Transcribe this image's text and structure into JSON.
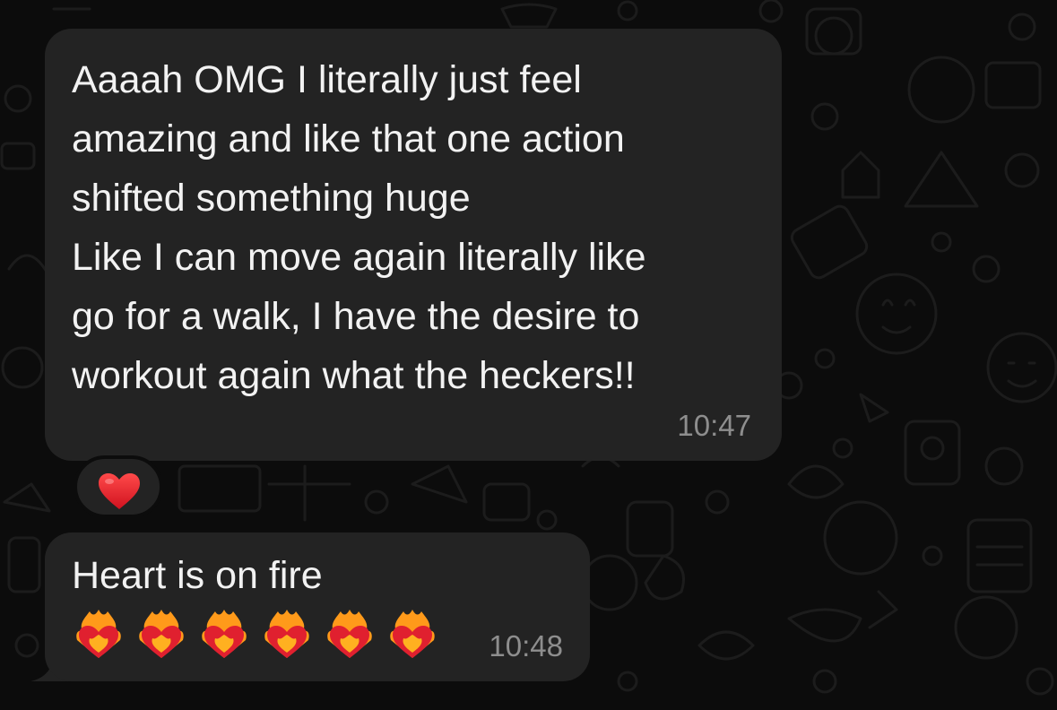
{
  "messages": [
    {
      "lines": [
        "Aaaah OMG I literally just feel",
        "amazing and like that one action",
        "shifted something huge",
        "Like I can move again literally like",
        "go for a walk, I have the desire to",
        "workout again what the heckers!!"
      ],
      "time": "10:47",
      "reaction": "red-heart-icon"
    },
    {
      "text": "Heart is on fire",
      "emojis": [
        "heart-on-fire-icon",
        "heart-on-fire-icon",
        "heart-on-fire-icon",
        "heart-on-fire-icon",
        "heart-on-fire-icon",
        "heart-on-fire-icon"
      ],
      "time": "10:48"
    }
  ],
  "colors": {
    "background": "#0c0c0c",
    "bubble": "#232323",
    "text": "#f2f2f2",
    "timestamp": "#8e8e8e",
    "heart_red": "#e0202f"
  }
}
